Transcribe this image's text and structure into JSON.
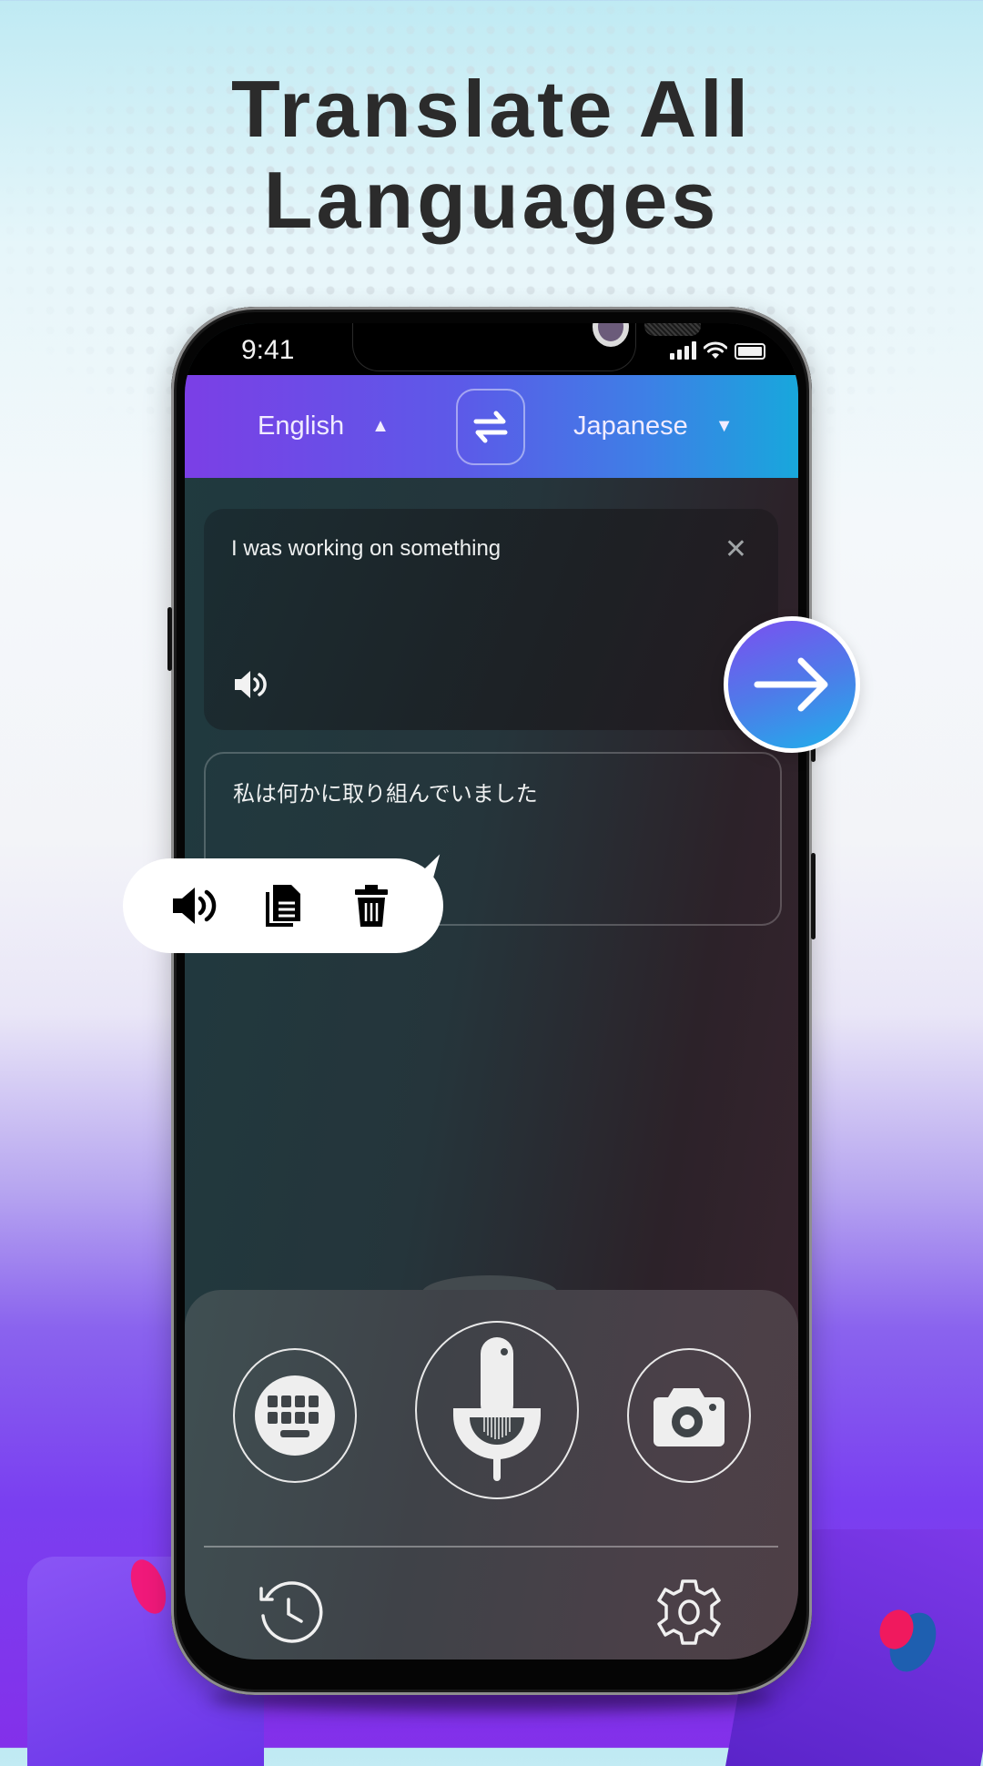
{
  "headline": {
    "line1": "Translate All",
    "line2": "Languages"
  },
  "status_bar": {
    "time": "9:41",
    "icons": [
      "signal-icon",
      "wifi-icon",
      "battery-icon"
    ]
  },
  "header": {
    "source_language": "English",
    "source_indicator": "▲",
    "swap_icon": "swap-arrows-icon",
    "target_language": "Japanese",
    "target_indicator": "▼"
  },
  "input_card": {
    "text": "I was working on something",
    "clear_icon": "close-icon",
    "clear_label": "✕",
    "speak_icon": "speaker-icon"
  },
  "translate_button": {
    "icon": "arrow-right-icon"
  },
  "output_card": {
    "text": "私は何かに取り組んでいました"
  },
  "output_actions": [
    {
      "name": "speak",
      "icon": "speaker-icon"
    },
    {
      "name": "copy",
      "icon": "copy-icon"
    },
    {
      "name": "delete",
      "icon": "trash-icon"
    }
  ],
  "input_modes": [
    {
      "name": "keyboard",
      "icon": "keyboard-icon"
    },
    {
      "name": "voice",
      "icon": "microphone-icon"
    },
    {
      "name": "camera",
      "icon": "camera-icon"
    }
  ],
  "bottom_nav": [
    {
      "name": "history",
      "icon": "history-icon"
    },
    {
      "name": "settings",
      "icon": "gear-icon"
    }
  ],
  "colors": {
    "header_gradient_start": "#7b3fe6",
    "header_gradient_end": "#18a7dc",
    "translate_button_start": "#7b4ff0",
    "translate_button_end": "#1eb0ea",
    "background_bottom": "#8330ea"
  }
}
